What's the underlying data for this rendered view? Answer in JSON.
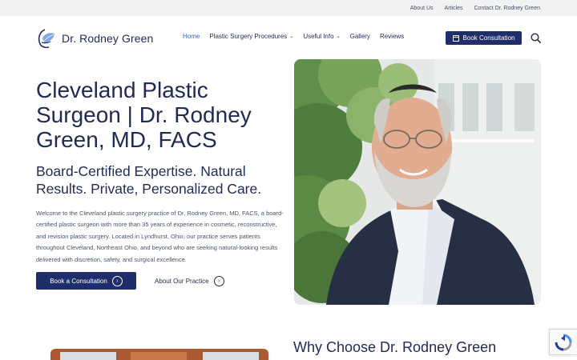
{
  "topbar": {
    "links": [
      "About Us",
      "Articles",
      "Contact Dr. Rodney Green"
    ]
  },
  "header": {
    "logo_text": "Dr. Rodney Green",
    "nav": [
      {
        "label": "Home",
        "active": true,
        "dropdown": false
      },
      {
        "label": "Plastic Surgery Procedures",
        "active": false,
        "dropdown": true
      },
      {
        "label": "Useful Info",
        "active": false,
        "dropdown": true
      },
      {
        "label": "Gallery",
        "active": false,
        "dropdown": false
      },
      {
        "label": "Reviews",
        "active": false,
        "dropdown": false
      }
    ],
    "book_button": "Book Consultation",
    "icons": {
      "book": "calendar-icon",
      "search": "search-icon",
      "dropdown": "chevron-down-icon"
    }
  },
  "hero": {
    "title": "Cleveland Plastic Surgeon | Dr. Rodney Green, MD, FACS",
    "subtitle": "Board-Certified Expertise. Natural Results. Private, Personalized Care.",
    "body": "Welcome to the Cleveland plastic surgery practice of Dr. Rodney Green, MD, FACS, a board-certified plastic surgeon with more than 35 years of experience in cosmetic, reconstructive, and revision plastic surgery. Located in Lyndhurst, Ohio, our practice serves patients throughout Cleveland, Northeast Ohio, and beyond who are seeking natural-looking results delivered with discretion, safety, and surgical excellence.",
    "cta_primary": "Book a Consultation",
    "cta_secondary": "About Our Practice",
    "arrow_glyph": "›"
  },
  "why": {
    "title": "Why Choose Dr. Rodney Green"
  },
  "colors": {
    "navy": "#1f2e6b",
    "text": "#1f2a55",
    "accent": "#2f63d6",
    "topbar_bg": "#f2f2f2"
  }
}
